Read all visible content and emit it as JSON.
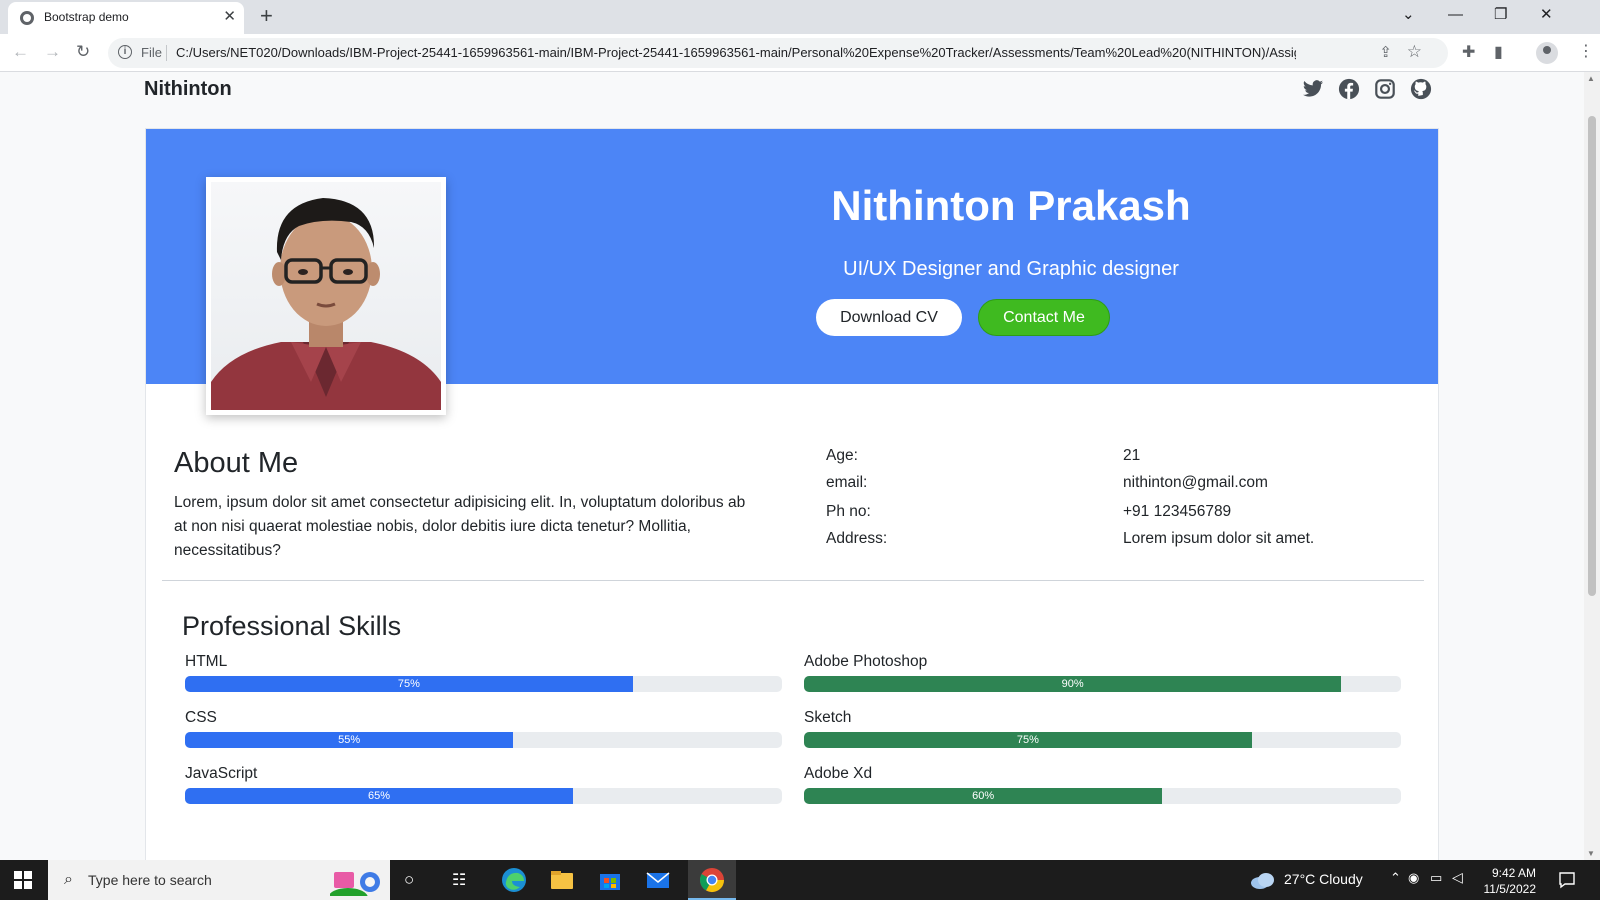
{
  "browser": {
    "tab_title": "Bootstrap demo",
    "tab_close": "✕",
    "new_tab": "+",
    "window_controls": [
      "⌄",
      "—",
      "❐",
      "✕"
    ],
    "nav": {
      "back": "←",
      "forward": "→",
      "reload": "↻"
    },
    "address_prefix": "File",
    "url": "C:/Users/NET020/Downloads/IBM-Project-25441-1659963561-main/IBM-Project-25441-1659963561-main/Personal%20Expense%20Tracker/Assessments/Team%20Lead%20(NITHINTON)/Assign...",
    "toolbar_icons": [
      "share-icon",
      "bookmark-star-icon",
      "extensions-icon",
      "side-panel-icon",
      "profile-icon",
      "menu-icon"
    ]
  },
  "site": {
    "brand": "Nithinton",
    "social_icons": [
      "twitter-icon",
      "facebook-icon",
      "instagram-icon",
      "github-icon"
    ]
  },
  "hero": {
    "name": "Nithinton Prakash",
    "role": "UI/UX Designer and Graphic designer",
    "download_cv": "Download CV",
    "contact_me": "Contact Me"
  },
  "about": {
    "title": "About Me",
    "text": "Lorem, ipsum dolor sit amet consectetur adipisicing elit. In, voluptatum doloribus ab at non nisi quaerat molestiae nobis, dolor debitis iure dicta tenetur? Mollitia, necessitatibus?"
  },
  "info": {
    "age_label": "Age:",
    "age_value": "21",
    "email_label": "email:",
    "email_value": "nithinton@gmail.com",
    "phone_label": "Ph no:",
    "phone_value": "+91 123456789",
    "address_label": "Address:",
    "address_value": "Lorem ipsum dolor sit amet."
  },
  "skills": {
    "title": "Professional Skills",
    "left": [
      {
        "name": "HTML",
        "percent": 75,
        "label": "75%"
      },
      {
        "name": "CSS",
        "percent": 55,
        "label": "55%"
      },
      {
        "name": "JavaScript",
        "percent": 65,
        "label": "65%"
      }
    ],
    "right": [
      {
        "name": "Adobe Photoshop",
        "percent": 90,
        "label": "90%"
      },
      {
        "name": "Sketch",
        "percent": 75,
        "label": "75%"
      },
      {
        "name": "Adobe Xd",
        "percent": 60,
        "label": "60%"
      }
    ],
    "colors": {
      "primary": "#2f6ff2",
      "success": "#2e8453",
      "track": "#e9ecef"
    }
  },
  "taskbar": {
    "search_placeholder": "Type here to search",
    "weather": "27°C  Cloudy",
    "time": "9:42 AM",
    "date": "11/5/2022",
    "apps": [
      "cortana-icon",
      "task-view-icon",
      "edge-icon",
      "file-explorer-icon",
      "store-icon",
      "mail-icon",
      "chrome-icon"
    ]
  },
  "colors": {
    "hero_bg": "#4c85f6",
    "contact_btn": "#3fba20"
  }
}
